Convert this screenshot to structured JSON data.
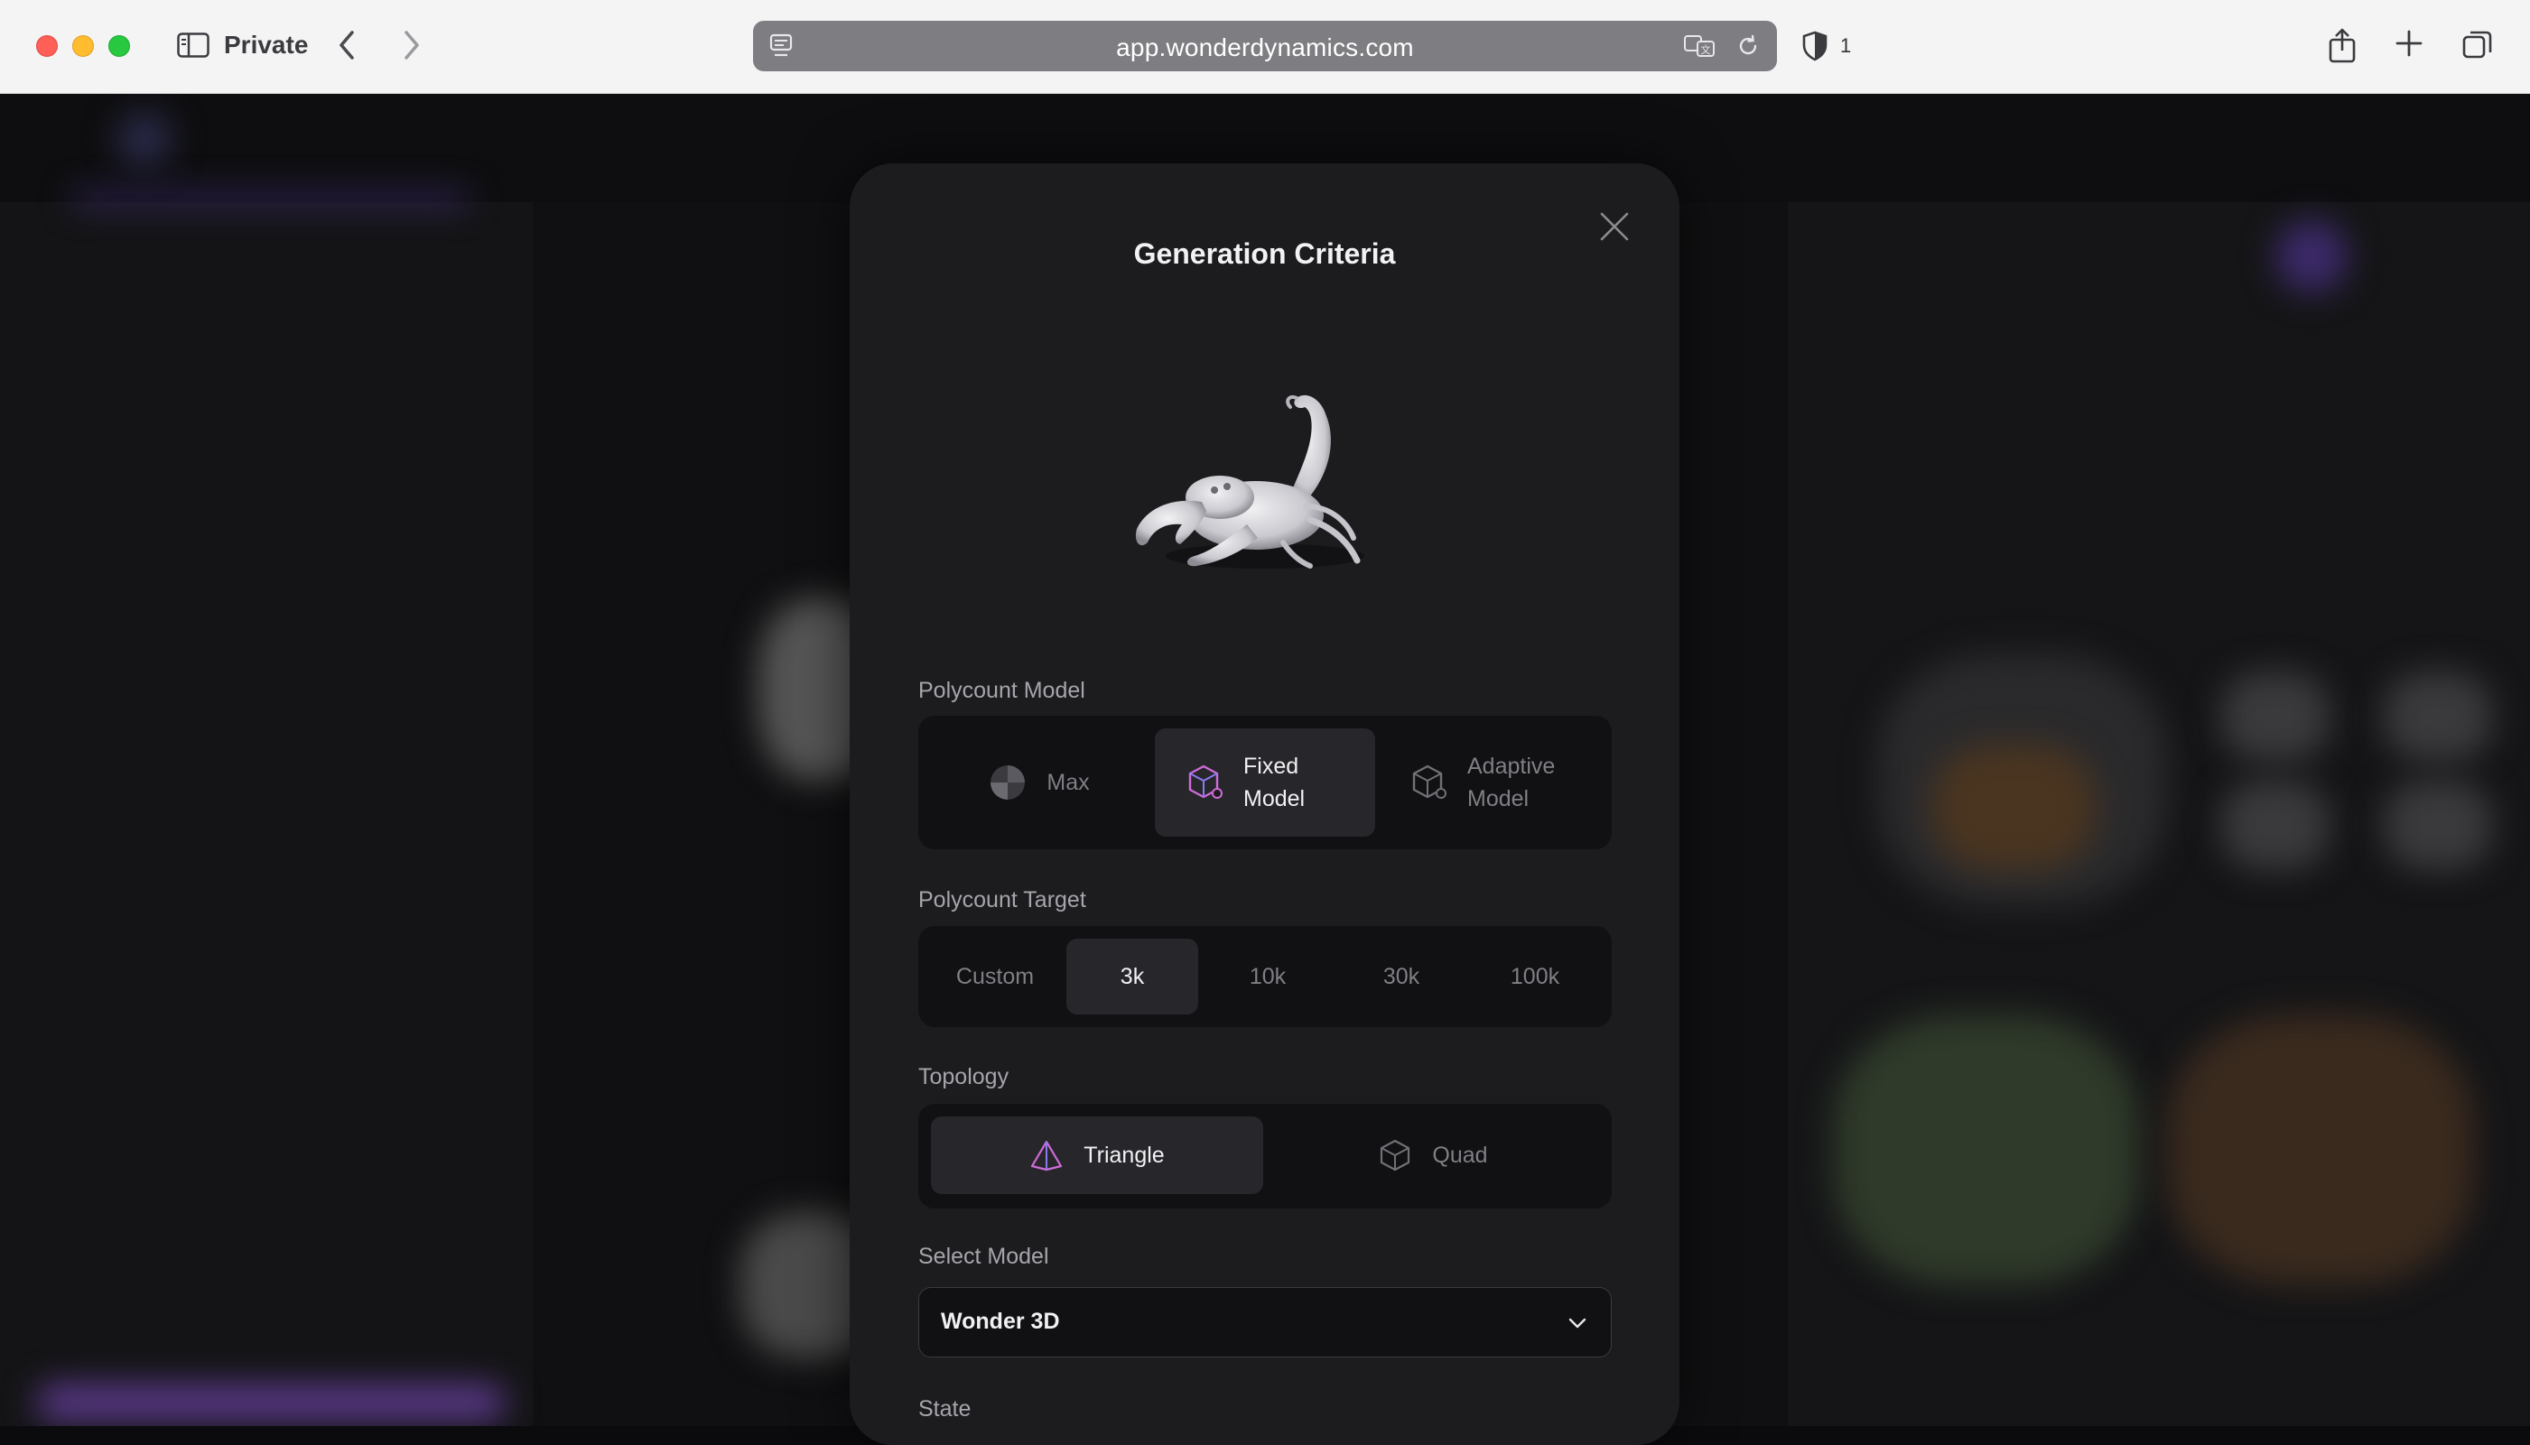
{
  "browser": {
    "mode_label": "Private",
    "url": "app.wonderdynamics.com",
    "shield_count": "1"
  },
  "modal": {
    "title": "Generation Criteria",
    "polycount_model": {
      "label": "Polycount Model",
      "options": [
        {
          "label": "Max",
          "active": false
        },
        {
          "label": "Fixed Model",
          "line1": "Fixed",
          "line2": "Model",
          "active": true
        },
        {
          "label": "Adaptive Model",
          "line1": "Adaptive",
          "line2": "Model",
          "active": false
        }
      ]
    },
    "polycount_target": {
      "label": "Polycount Target",
      "options": [
        "Custom",
        "3k",
        "10k",
        "30k",
        "100k"
      ],
      "selected": "3k"
    },
    "topology": {
      "label": "Topology",
      "options": [
        "Triangle",
        "Quad"
      ],
      "selected": "Triangle"
    },
    "select_model": {
      "label": "Select Model",
      "value": "Wonder 3D"
    },
    "state": {
      "label": "State"
    }
  },
  "icons": {
    "site": "site-info-icon",
    "translate": "translate-icon",
    "reload": "reload-icon",
    "shield": "privacy-shield-icon",
    "share": "share-icon",
    "new_tab": "plus-icon",
    "tab_overview": "tab-overview-icon",
    "close": "close-icon"
  },
  "colors": {
    "modal_bg": "#1c1c1f",
    "segment_bg": "#111113",
    "segment_active": "#27272b"
  }
}
